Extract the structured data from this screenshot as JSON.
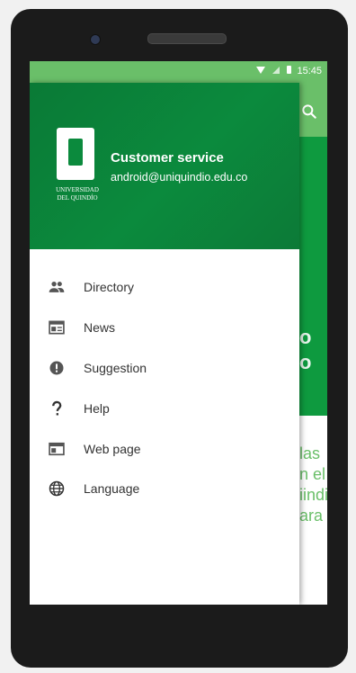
{
  "status_bar": {
    "time": "15:45"
  },
  "drawer": {
    "logo": {
      "line1": "UNIVERSIDAD",
      "line2": "DEL QUINDÍO"
    },
    "user": {
      "name": "Customer service",
      "email": "android@uniquindio.edu.co"
    },
    "menu": [
      {
        "label": "Directory",
        "icon": "people-icon"
      },
      {
        "label": "News",
        "icon": "news-icon"
      },
      {
        "label": "Suggestion",
        "icon": "exclamation-icon"
      },
      {
        "label": "Help",
        "icon": "question-mark-icon"
      },
      {
        "label": "Web page",
        "icon": "web-page-icon"
      },
      {
        "label": "Language",
        "icon": "globe-icon"
      }
    ]
  },
  "background": {
    "banner_glyphs": [
      "o",
      "o"
    ],
    "text_lines": [
      "las",
      "n el",
      "iindio,",
      "ara el"
    ]
  },
  "colors": {
    "accent": "#6abf69",
    "header_green": "#0b8a3d",
    "banner_green": "#0e9a3f",
    "icon_color": "#555555"
  }
}
